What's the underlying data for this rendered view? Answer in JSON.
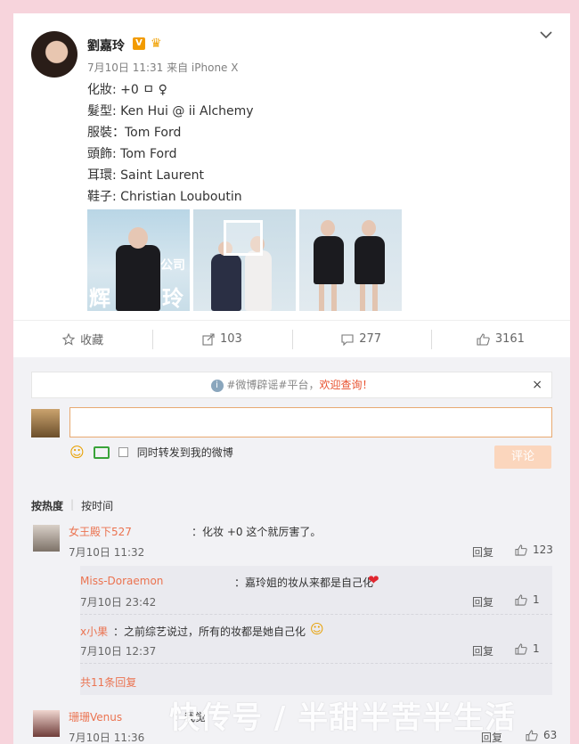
{
  "post": {
    "author": "劉嘉玲",
    "vip_badge": "V",
    "meta": "7月10日 11:31 来自 iPhone X",
    "lines": [
      "化妝: +0 ㅁ ♀",
      "髮型: Ken Hui @ ii Alchemy",
      "服裝：Tom Ford",
      "頭飾: Tom Ford",
      "耳環: Saint Laurent",
      "鞋子: Christian Louboutin"
    ],
    "thumb_text": [
      "辉",
      "玲",
      "公司"
    ]
  },
  "actions": {
    "fav": "收藏",
    "share": "103",
    "comment": "277",
    "like": "3161"
  },
  "notice": {
    "tag": "#微博辟谣#平台，",
    "highlight": "欢迎查询！",
    "close": "×"
  },
  "composer": {
    "checkbox_label": "同时转发到我的微博",
    "submit": "评论"
  },
  "sorts": {
    "hot": "按热度",
    "sep": "|",
    "time": "按时间"
  },
  "comments": [
    {
      "name": "女王殿下527",
      "text": "：化妆 +0 这个就厉害了。",
      "time": "7月10日 11:32",
      "reply": "回复",
      "likes": "123"
    },
    {
      "name": "珊珊Venus",
      "text": "：我觉",
      "time": "7月10日 11:36",
      "reply": "回复",
      "likes": "63"
    }
  ],
  "subcomments": [
    {
      "name": "Miss-Doraemon",
      "text": "：嘉玲姐的妆从来都是自己化",
      "time": "7月10日 23:42",
      "reply": "回复",
      "likes": "1"
    },
    {
      "name": "x小果",
      "text": "：之前综艺说过，所有的妆都是她自己化",
      "time": "7月10日 12:37",
      "reply": "回复",
      "likes": "1"
    }
  ],
  "more_replies": "共11条回复",
  "watermark": "快传号 / 半甜半苦半生活",
  "colors": {
    "background": "#f7d4dc",
    "accent": "#eb7350",
    "vip": "#f29b00"
  }
}
